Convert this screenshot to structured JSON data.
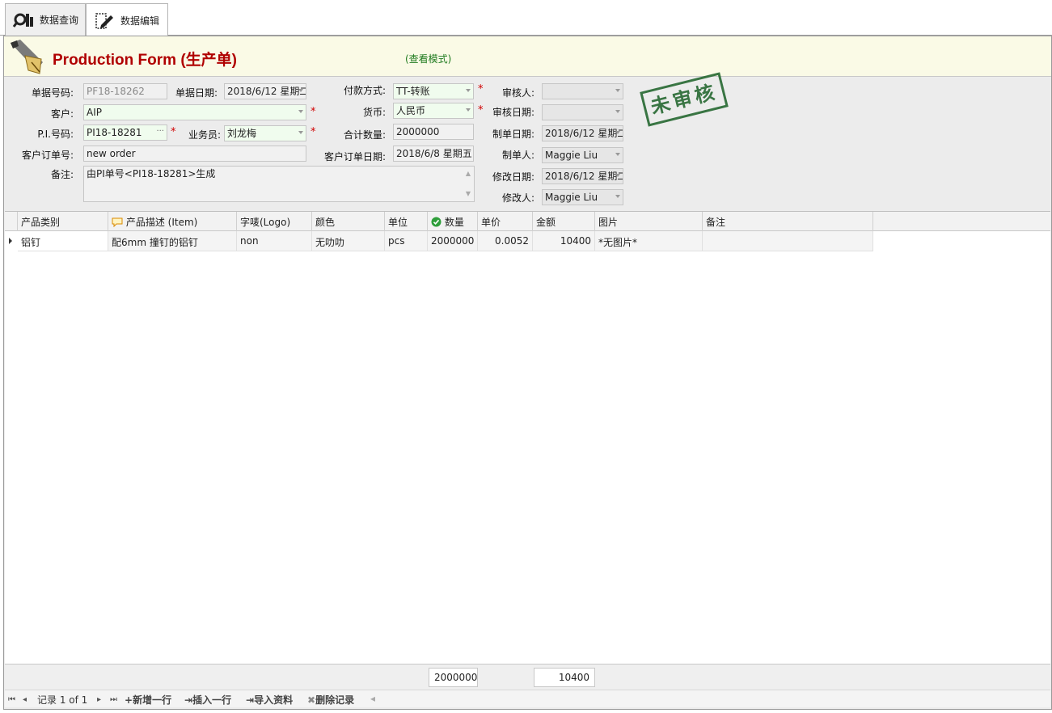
{
  "tabs": [
    {
      "label": "数据查询"
    },
    {
      "label": "数据编辑"
    }
  ],
  "header": {
    "title": "Production Form (生产单)",
    "mode": "(查看模式)",
    "stamp": "未审核"
  },
  "form": {
    "doc_no": {
      "label": "单据号码:",
      "value": "PF18-18262"
    },
    "doc_date": {
      "label": "单据日期:",
      "value": "2018/6/12 星期二"
    },
    "payment": {
      "label": "付款方式:",
      "value": "TT-转账"
    },
    "reviewer": {
      "label": "审核人:",
      "value": ""
    },
    "customer": {
      "label": "客户:",
      "value": "AIP"
    },
    "currency": {
      "label": "货币:",
      "value": "人民币"
    },
    "review_date": {
      "label": "审核日期:",
      "value": ""
    },
    "pi_no": {
      "label": "P.I.号码:",
      "value": "PI18-18281"
    },
    "salesman": {
      "label": "业务员:",
      "value": "刘龙梅"
    },
    "total_qty": {
      "label": "合计数量:",
      "value": "2000000"
    },
    "make_date": {
      "label": "制单日期:",
      "value": "2018/6/12 星期二"
    },
    "cust_order_no": {
      "label": "客户订单号:",
      "value": "new order"
    },
    "cust_order_date": {
      "label": "客户订单日期:",
      "value": "2018/6/8 星期五"
    },
    "maker": {
      "label": "制单人:",
      "value": "Maggie Liu"
    },
    "remark": {
      "label": "备注:",
      "value": "由PI单号<PI18-18281>生成"
    },
    "modify_date": {
      "label": "修改日期:",
      "value": "2018/6/12 星期二"
    },
    "modifier": {
      "label": "修改人:",
      "value": "Maggie Liu"
    },
    "required_mark": "*"
  },
  "grid": {
    "columns": [
      "产品类别",
      "产品描述 (Item)",
      "字唛(Logo)",
      "颜色",
      "单位",
      "数量",
      "单价",
      "金额",
      "图片",
      "备注"
    ],
    "rows": [
      [
        "铝钉",
        "配6mm 撞钉的铝钉",
        "non",
        "无叻叻",
        "pcs",
        "2000000",
        "0.0052",
        "10400",
        "*无图片*",
        ""
      ]
    ]
  },
  "footer": {
    "qty_total": "2000000",
    "amount_total": "10400"
  },
  "navigator": {
    "record_text": "记录 1 of 1",
    "add_row": "新增一行",
    "insert_row": "插入一行",
    "import": "导入资料",
    "delete": "删除记录"
  }
}
